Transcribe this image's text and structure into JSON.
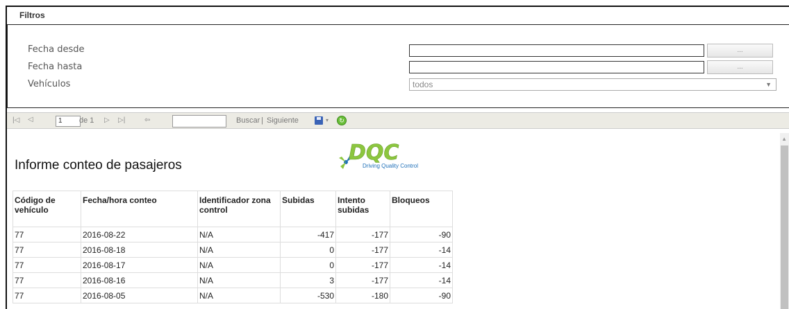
{
  "filters": {
    "title": "Filtros",
    "fecha_desde_label": "Fecha desde",
    "fecha_hasta_label": "Fecha hasta",
    "vehiculos_label": "Vehículos",
    "fecha_desde_value": "",
    "fecha_hasta_value": "",
    "picker_label": "...",
    "vehiculos_selected": "todos"
  },
  "toolbar": {
    "page_value": "1",
    "page_of": "de 1",
    "buscar": "Buscar",
    "separator": "|",
    "siguiente": "Siguiente",
    "search_value": ""
  },
  "report": {
    "title": "Informe conteo de pasajeros",
    "logo_text": "DQC",
    "logo_tagline": "Driving Quality Control",
    "columns": [
      "Código de vehículo",
      "Fecha/hora conteo",
      "Identificador zona control",
      "Subidas",
      "Intento subidas",
      "Bloqueos"
    ],
    "rows": [
      [
        "77",
        "2016-08-22",
        "N/A",
        "-417",
        "-177",
        "-90"
      ],
      [
        "77",
        "2016-08-18",
        "N/A",
        "0",
        "-177",
        "-14"
      ],
      [
        "77",
        "2016-08-17",
        "N/A",
        "0",
        "-177",
        "-14"
      ],
      [
        "77",
        "2016-08-16",
        "N/A",
        "3",
        "-177",
        "-14"
      ],
      [
        "77",
        "2016-08-05",
        "N/A",
        "-530",
        "-180",
        "-90"
      ]
    ]
  },
  "colors": {
    "logo_green": "#8cc63f",
    "logo_blue": "#1e6fb8",
    "toolbar_bg": "#ecebe4"
  }
}
